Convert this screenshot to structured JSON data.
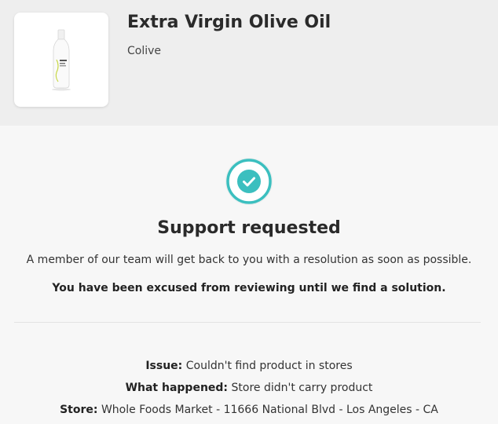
{
  "product": {
    "title": "Extra Virgin Olive Oil",
    "brand": "Colive",
    "bottle_label": "OLIVE OIL"
  },
  "status": {
    "icon": "check-circle-icon",
    "accent_color": "#3bbfbf",
    "headline": "Support requested",
    "message": "A member of our team will get back to you with a resolution as soon as possible.",
    "note": "You have been excused from reviewing until we find a solution."
  },
  "details": {
    "issue_label": "Issue:",
    "issue_value": "Couldn't find product in stores",
    "happened_label": "What happened:",
    "happened_value": "Store didn't carry product",
    "store_label": "Store:",
    "store_value": "Whole Foods Market - 11666 National Blvd - Los Angeles - CA"
  }
}
